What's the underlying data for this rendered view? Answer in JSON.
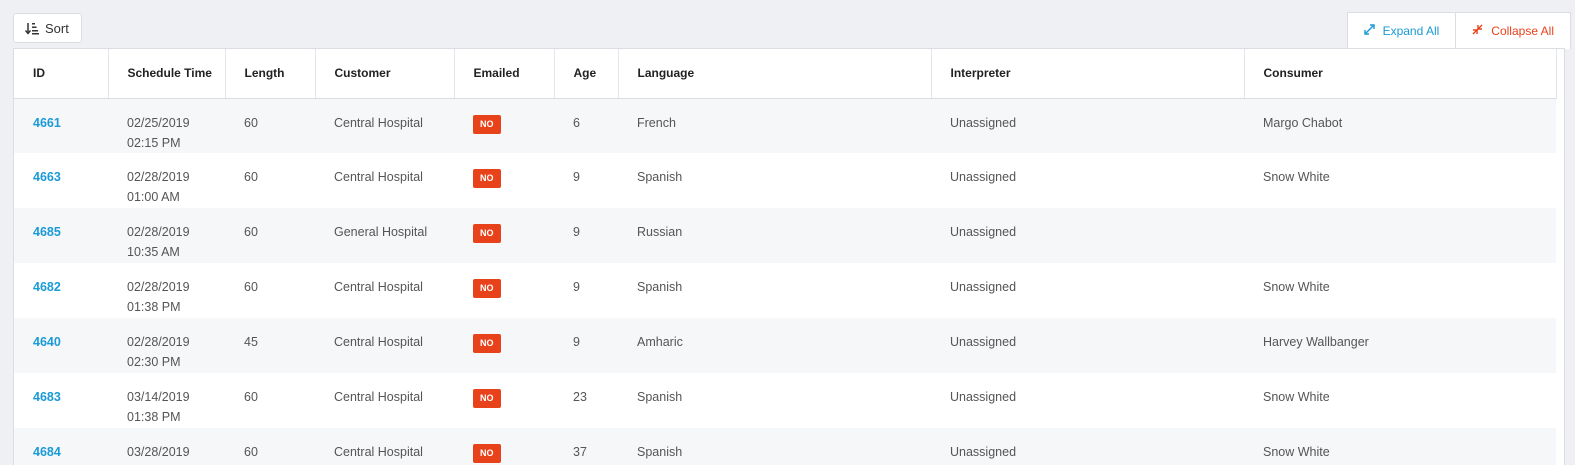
{
  "toolbar": {
    "sort_label": "Sort",
    "expand_label": "Expand All",
    "collapse_label": "Collapse All"
  },
  "columns": [
    "ID",
    "Schedule Time",
    "Length",
    "Customer",
    "Emailed",
    "Age",
    "Language",
    "Interpreter",
    "Consumer"
  ],
  "rows": [
    {
      "id": "4661",
      "date": "02/25/2019",
      "time": "02:15 PM",
      "length": "60",
      "customer": "Central Hospital",
      "emailed": "NO",
      "age": "6",
      "language": "French",
      "interpreter": "Unassigned",
      "consumer": "Margo Chabot"
    },
    {
      "id": "4663",
      "date": "02/28/2019",
      "time": "01:00 AM",
      "length": "60",
      "customer": "Central Hospital",
      "emailed": "NO",
      "age": "9",
      "language": "Spanish",
      "interpreter": "Unassigned",
      "consumer": "Snow White"
    },
    {
      "id": "4685",
      "date": "02/28/2019",
      "time": "10:35 AM",
      "length": "60",
      "customer": "General Hospital",
      "emailed": "NO",
      "age": "9",
      "language": "Russian",
      "interpreter": "Unassigned",
      "consumer": ""
    },
    {
      "id": "4682",
      "date": "02/28/2019",
      "time": "01:38 PM",
      "length": "60",
      "customer": "Central Hospital",
      "emailed": "NO",
      "age": "9",
      "language": "Spanish",
      "interpreter": "Unassigned",
      "consumer": "Snow White"
    },
    {
      "id": "4640",
      "date": "02/28/2019",
      "time": "02:30 PM",
      "length": "45",
      "customer": "Central Hospital",
      "emailed": "NO",
      "age": "9",
      "language": "Amharic",
      "interpreter": "Unassigned",
      "consumer": "Harvey Wallbanger"
    },
    {
      "id": "4683",
      "date": "03/14/2019",
      "time": "01:38 PM",
      "length": "60",
      "customer": "Central Hospital",
      "emailed": "NO",
      "age": "23",
      "language": "Spanish",
      "interpreter": "Unassigned",
      "consumer": "Snow White"
    },
    {
      "id": "4684",
      "date": "03/28/2019",
      "time": "",
      "length": "60",
      "customer": "Central Hospital",
      "emailed": "NO",
      "age": "37",
      "language": "Spanish",
      "interpreter": "Unassigned",
      "consumer": "Snow White"
    }
  ],
  "colors": {
    "link": "#1a9ad6",
    "badge": "#e8421b",
    "collapse": "#e8421b"
  },
  "icons": {
    "sort": "sort-icon",
    "expand": "expand-arrows-icon",
    "collapse": "collapse-arrows-icon"
  }
}
